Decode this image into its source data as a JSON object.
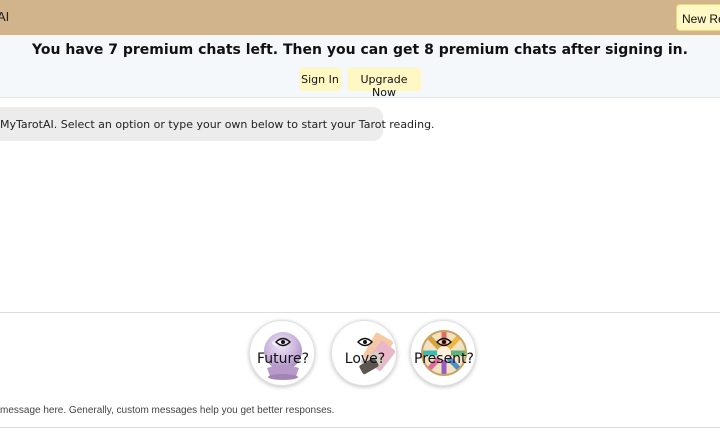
{
  "header": {
    "app_title": "AI",
    "new_reading_label": "New Rea"
  },
  "banner": {
    "message": "You have 7 premium chats left. Then you can get 8 premium chats after signing in.",
    "sign_in_label": "Sign In",
    "upgrade_label": "Upgrade Now"
  },
  "chat": {
    "messages": [
      {
        "text": "MyTarotAI. Select an option or type your own below to start your Tarot reading."
      }
    ]
  },
  "options": [
    {
      "label": "Future?",
      "icon": "crystal-ball-icon"
    },
    {
      "label": "Love?",
      "icon": "tarot-cards-icon"
    },
    {
      "label": "Present?",
      "icon": "tarot-wheel-icon"
    }
  ],
  "input": {
    "hint": "message here. Generally, custom messages help you get better responses."
  },
  "colors": {
    "header_bg": "#d2b48c",
    "button_bg": "#fff8c4",
    "banner_bg": "#f5f8fb",
    "bubble_bg": "#ececec"
  }
}
